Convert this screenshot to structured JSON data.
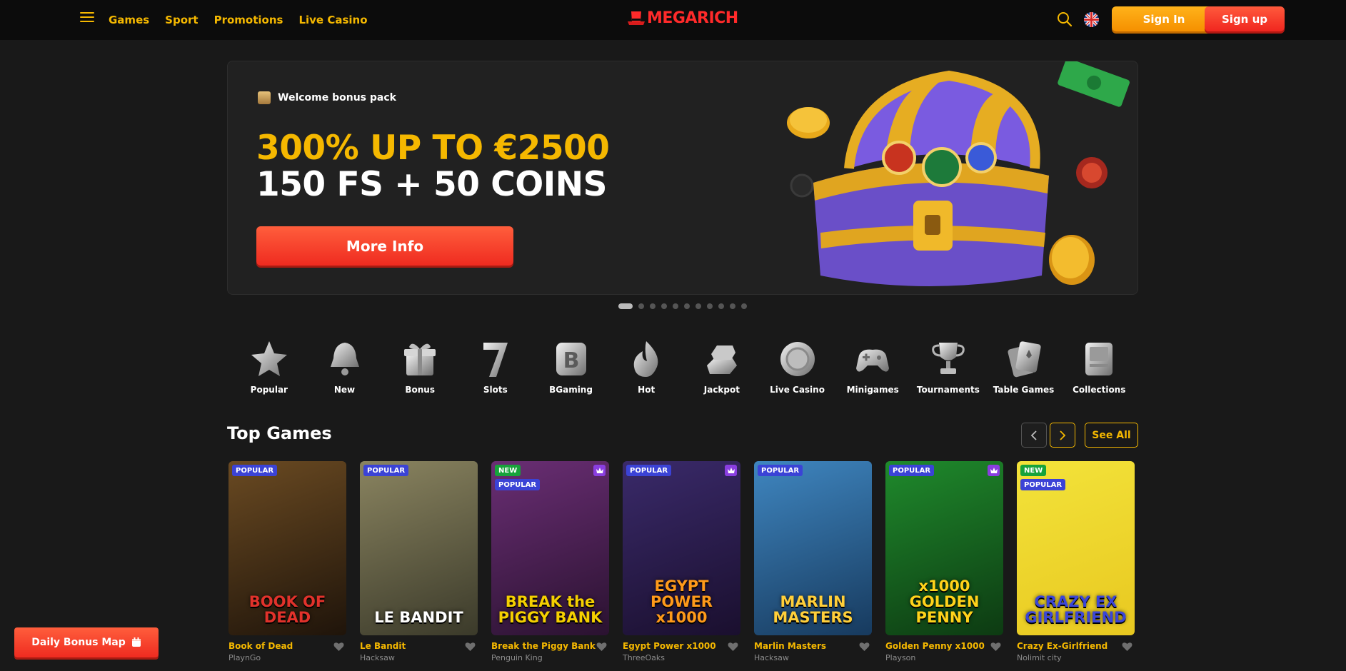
{
  "header": {
    "nav": [
      "Games",
      "Sport",
      "Promotions",
      "Live Casino"
    ],
    "logo": "MEGARICH",
    "sign_in": "Sign In",
    "sign_up": "Sign up"
  },
  "hero": {
    "tag": "Welcome bonus pack",
    "line1": "300% UP TO €2500",
    "line2": "150 FS + 50 COINS",
    "button": "More Info",
    "slides_total": 11,
    "slide_active": 1
  },
  "categories": [
    "Popular",
    "New",
    "Bonus",
    "Slots",
    "BGaming",
    "Hot",
    "Jackpot",
    "Live Casino",
    "Minigames",
    "Tournaments",
    "Table Games",
    "Collections"
  ],
  "top_games": {
    "title": "Top Games",
    "see_all": "See All",
    "items": [
      {
        "name": "Book of Dead",
        "provider": "PlaynGo",
        "badges": [
          "POPULAR"
        ],
        "crown": false,
        "art": "BOOK OF DEAD",
        "bg": "#6a4a22",
        "bg2": "#1f140a",
        "title_color": "#e2322b"
      },
      {
        "name": "Le Bandit",
        "provider": "Hacksaw",
        "badges": [
          "POPULAR"
        ],
        "crown": false,
        "art": "LE BANDIT",
        "bg": "#8a8460",
        "bg2": "#3b3a2a",
        "title_color": "#ffffff"
      },
      {
        "name": "Break the Piggy Bank",
        "provider": "Penguin King",
        "badges": [
          "NEW",
          "POPULAR"
        ],
        "crown": true,
        "art": "BREAK the PIGGY BANK",
        "bg": "#6a2e74",
        "bg2": "#2a1230",
        "title_color": "#f5d000"
      },
      {
        "name": "Egypt Power x1000",
        "provider": "ThreeOaks",
        "badges": [
          "POPULAR"
        ],
        "crown": true,
        "art": "EGYPT POWER x1000",
        "bg": "#3a2a6a",
        "bg2": "#1a0f2e",
        "title_color": "#ff9a1a"
      },
      {
        "name": "Marlin Masters",
        "provider": "Hacksaw",
        "badges": [
          "POPULAR"
        ],
        "crown": false,
        "art": "MARLIN MASTERS",
        "bg": "#3f86c0",
        "bg2": "#173a5e",
        "title_color": "#ffcf3a"
      },
      {
        "name": "Golden Penny x1000",
        "provider": "Playson",
        "badges": [
          "POPULAR"
        ],
        "crown": true,
        "art": "x1000 GOLDEN PENNY",
        "bg": "#1f8a2c",
        "bg2": "#0d3a12",
        "title_color": "#ffd21a"
      },
      {
        "name": "Crazy Ex-Girlfriend",
        "provider": "Nolimit city",
        "badges": [
          "NEW",
          "POPULAR"
        ],
        "crown": false,
        "art": "CRAZY EX GIRLFRIEND",
        "bg": "#f3e33a",
        "bg2": "#e8c820",
        "title_color": "#3b46d8"
      }
    ]
  },
  "daily_bonus": "Daily Bonus Map",
  "colors": {
    "accent": "#f5b800",
    "red": "#ef2b20",
    "orange": "#f59000",
    "bg": "#191919"
  }
}
